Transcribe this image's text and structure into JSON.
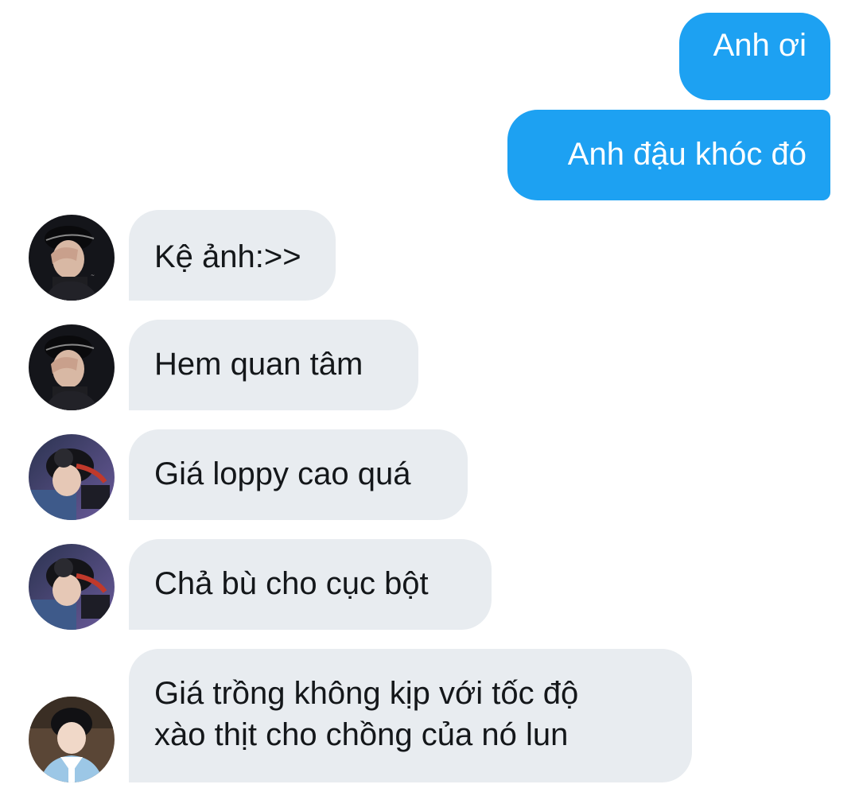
{
  "messages": {
    "outgoing": [
      {
        "text": "Anh ơi"
      },
      {
        "text": "Anh đậu khóc đó"
      }
    ],
    "incoming": [
      {
        "text": "Kệ ảnh:>>",
        "avatar": "dark-portrait-avatar"
      },
      {
        "text": "Hem quan tâm",
        "avatar": "dark-portrait-avatar"
      },
      {
        "text": "Giá loppy cao quá",
        "avatar": "headset-gamer-avatar"
      },
      {
        "text": "Chả bù cho cục bột",
        "avatar": "headset-gamer-avatar"
      },
      {
        "lines": [
          "Giá trồng không kịp với tốc độ",
          "xào thịt cho chồng của nó lun"
        ],
        "avatar": "hanbok-avatar"
      }
    ]
  },
  "colors": {
    "outgoing_bubble": "#1da1f2",
    "incoming_bubble": "#e8ecf0",
    "incoming_text": "#14171a",
    "background": "#ffffff"
  }
}
